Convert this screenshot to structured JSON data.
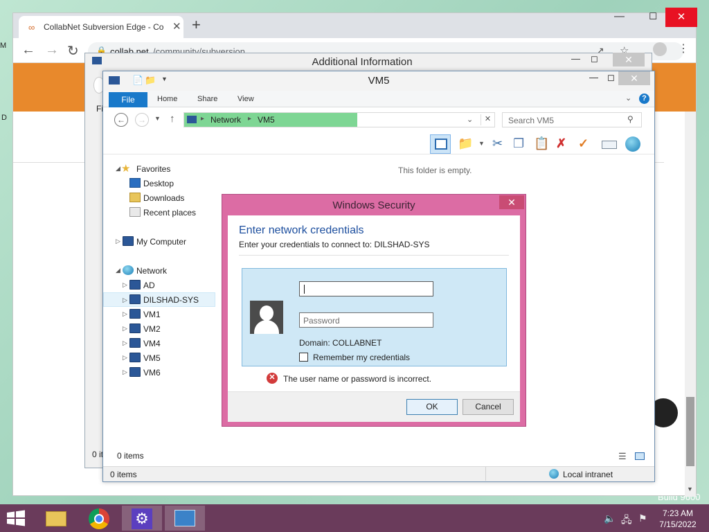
{
  "browser": {
    "tab_title": "CollabNet Subversion Edge - Co",
    "url_host": "collab.net",
    "url_path": "/community/subversion",
    "side_letter_1": "M",
    "side_letter_2": "D",
    "new_tab_label": "+"
  },
  "additional_info": {
    "title": "Additional Information",
    "fragment_f": "Fi",
    "fragment_items": "0 it"
  },
  "explorer": {
    "title": "VM5",
    "ribbon_tabs": [
      "File",
      "Home",
      "Share",
      "View"
    ],
    "breadcrumb": [
      "Network",
      "VM5"
    ],
    "search_placeholder": "Search VM5",
    "nav": {
      "favorites": "Favorites",
      "favorites_items": [
        "Desktop",
        "Downloads",
        "Recent places"
      ],
      "my_computer": "My Computer",
      "network": "Network",
      "network_items": [
        "AD",
        "DILSHAD-SYS",
        "VM1",
        "VM2",
        "VM4",
        "VM5",
        "VM6"
      ]
    },
    "empty_message": "This folder is empty.",
    "items_count": "0 items",
    "status_items": "0 items",
    "zone": "Local intranet"
  },
  "security_dialog": {
    "window_title": "Windows Security",
    "heading": "Enter network credentials",
    "subheading": "Enter your credentials to connect to: DILSHAD-SYS",
    "username_value": "",
    "password_placeholder": "Password",
    "domain": "Domain: COLLABNET",
    "remember_label": "Remember my credentials",
    "remember_checked": false,
    "error_text": "The user name or password is incorrect.",
    "ok_label": "OK",
    "cancel_label": "Cancel"
  },
  "taskbar": {
    "time": "7:23 AM",
    "date": "7/15/2022",
    "desktop_text": "Build 9600"
  },
  "colors": {
    "dialog_frame": "#dc6ca4",
    "address_highlight": "#7ed694",
    "ribbon_file": "#1979ca",
    "taskbar": "#6a3b5b",
    "page_banner": "#e8892c"
  }
}
